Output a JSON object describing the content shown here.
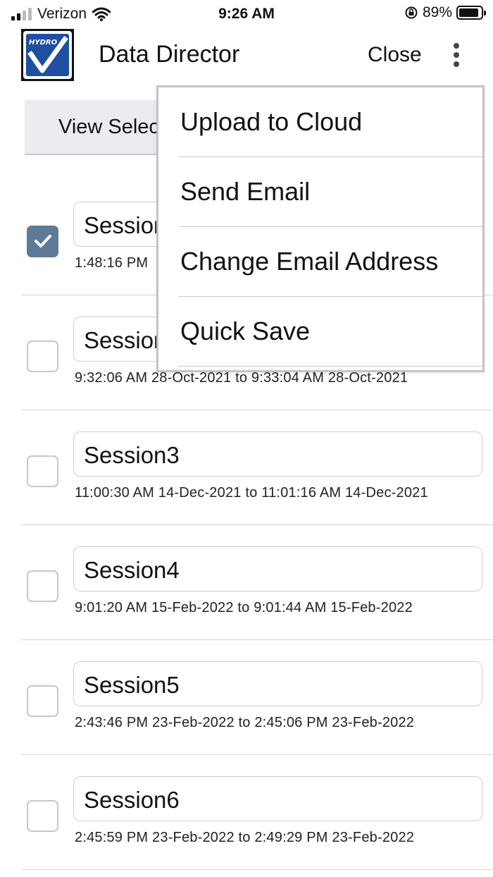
{
  "status_bar": {
    "carrier": "Verizon",
    "time": "9:26 AM",
    "battery_percent": "89%",
    "battery_level": 0.89
  },
  "header": {
    "logo_text": "HYDRO",
    "title": "Data Director",
    "close_label": "Close",
    "more_icon": "vertical-ellipsis-icon"
  },
  "view_selected_label": "View Selected",
  "sessions": [
    {
      "name": "Session1",
      "range": "1:48:16 PM",
      "checked": true
    },
    {
      "name": "Session2",
      "range": "9:32:06 AM 28-Oct-2021 to 9:33:04 AM 28-Oct-2021",
      "checked": false
    },
    {
      "name": "Session3",
      "range": "11:00:30 AM 14-Dec-2021 to 11:01:16 AM 14-Dec-2021",
      "checked": false
    },
    {
      "name": "Session4",
      "range": "9:01:20 AM 15-Feb-2022 to 9:01:44 AM 15-Feb-2022",
      "checked": false
    },
    {
      "name": "Session5",
      "range": "2:43:46 PM 23-Feb-2022 to 2:45:06 PM 23-Feb-2022",
      "checked": false
    },
    {
      "name": "Session6",
      "range": "2:45:59 PM 23-Feb-2022 to 2:49:29 PM 23-Feb-2022",
      "checked": false
    }
  ],
  "menu": {
    "items": [
      "Upload to Cloud",
      "Send Email",
      "Change Email Address",
      "Quick Save"
    ]
  },
  "colors": {
    "checkbox_checked": "#5d7a96",
    "logo_blue": "#1e4fa0"
  }
}
